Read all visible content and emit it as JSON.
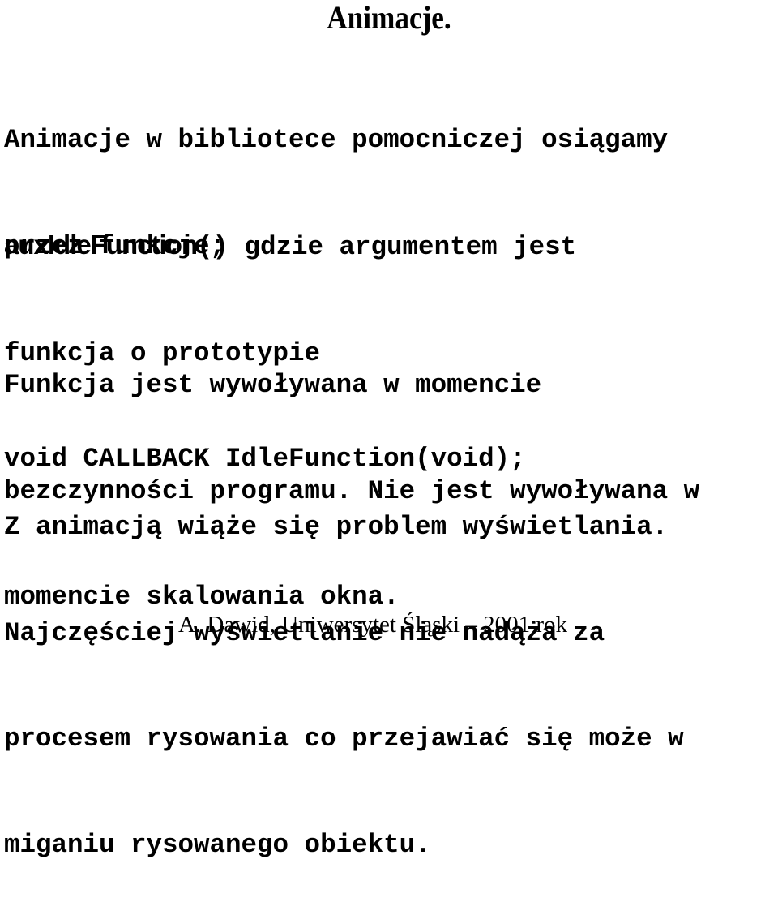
{
  "title": "Animacje.",
  "paragraph1": {
    "lines": [
      "Animacje w bibliotece pomocniczej osiągamy",
      "przez funkcje;"
    ]
  },
  "paragraph2": {
    "function_name": "auxIdleFunction",
    "line1_rest": "() gdzie argumentem jest",
    "lines": [
      "funkcja o prototypie",
      "void CALLBACK IdleFunction(void);"
    ]
  },
  "paragraph3": {
    "lines": [
      "Funkcja jest wywoływana w momencie",
      "bezczynności programu. Nie jest wywoływana w",
      "momencie skalowania okna."
    ]
  },
  "paragraph4": {
    "lines": [
      "Z animacją wiąże się problem wyświetlania.",
      "Najczęściej wyświetlanie nie nadąża za",
      "procesem rysowania co przejawiać się może w",
      "miganiu rysowanego obiektu."
    ]
  },
  "footer": "A. Dawid, Uniwersytet Śląski – 2001 rok"
}
